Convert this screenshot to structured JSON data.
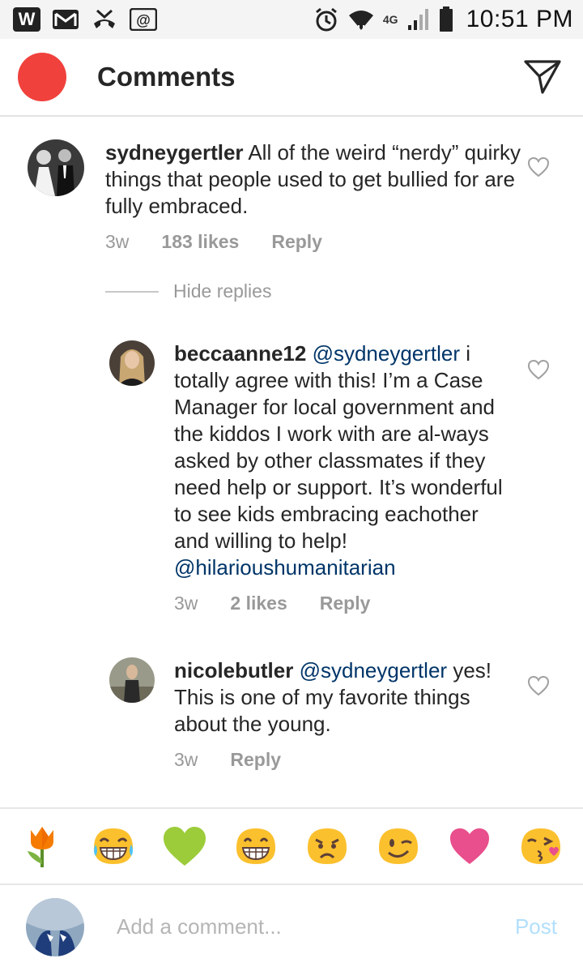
{
  "status_bar": {
    "time": "10:51 PM",
    "network": "4G"
  },
  "header": {
    "title": "Comments"
  },
  "hide_replies_label": "Hide replies",
  "comments": [
    {
      "username": "sydneygertler",
      "text": "All of the weird “nerdy” quirky things that people used to get bullied for are fully embraced.",
      "time": "3w",
      "likes": "183 likes",
      "reply_label": "Reply"
    },
    {
      "username": "beccaanne12",
      "mention": "@sydneygertler",
      "text": "i totally agree with this! I’m a Case Manager for local government and the kiddos I work with are al-ways asked by other classmates if they need help or support. It’s wonderful to see kids embracing eachother and willing to help!",
      "mention2": "@hilarioushumanitarian",
      "time": "3w",
      "likes": "2 likes",
      "reply_label": "Reply"
    },
    {
      "username": "nicolebutler",
      "mention": "@sydneygertler",
      "text": "yes! This is one of my favorite things about the young.",
      "time": "3w",
      "reply_label": "Reply"
    }
  ],
  "emoji_bar": [
    "tulip-emoji",
    "laughing-emoji",
    "green-heart-emoji",
    "grinning-emoji",
    "frowning-emoji",
    "winking-emoji",
    "pink-heart-emoji",
    "kissing-emoji"
  ],
  "input": {
    "placeholder": "Add a comment...",
    "post_label": "Post"
  },
  "colors": {
    "header_dot": "#f0413c",
    "mention": "#003569",
    "post_disabled": "#b2dffc"
  }
}
